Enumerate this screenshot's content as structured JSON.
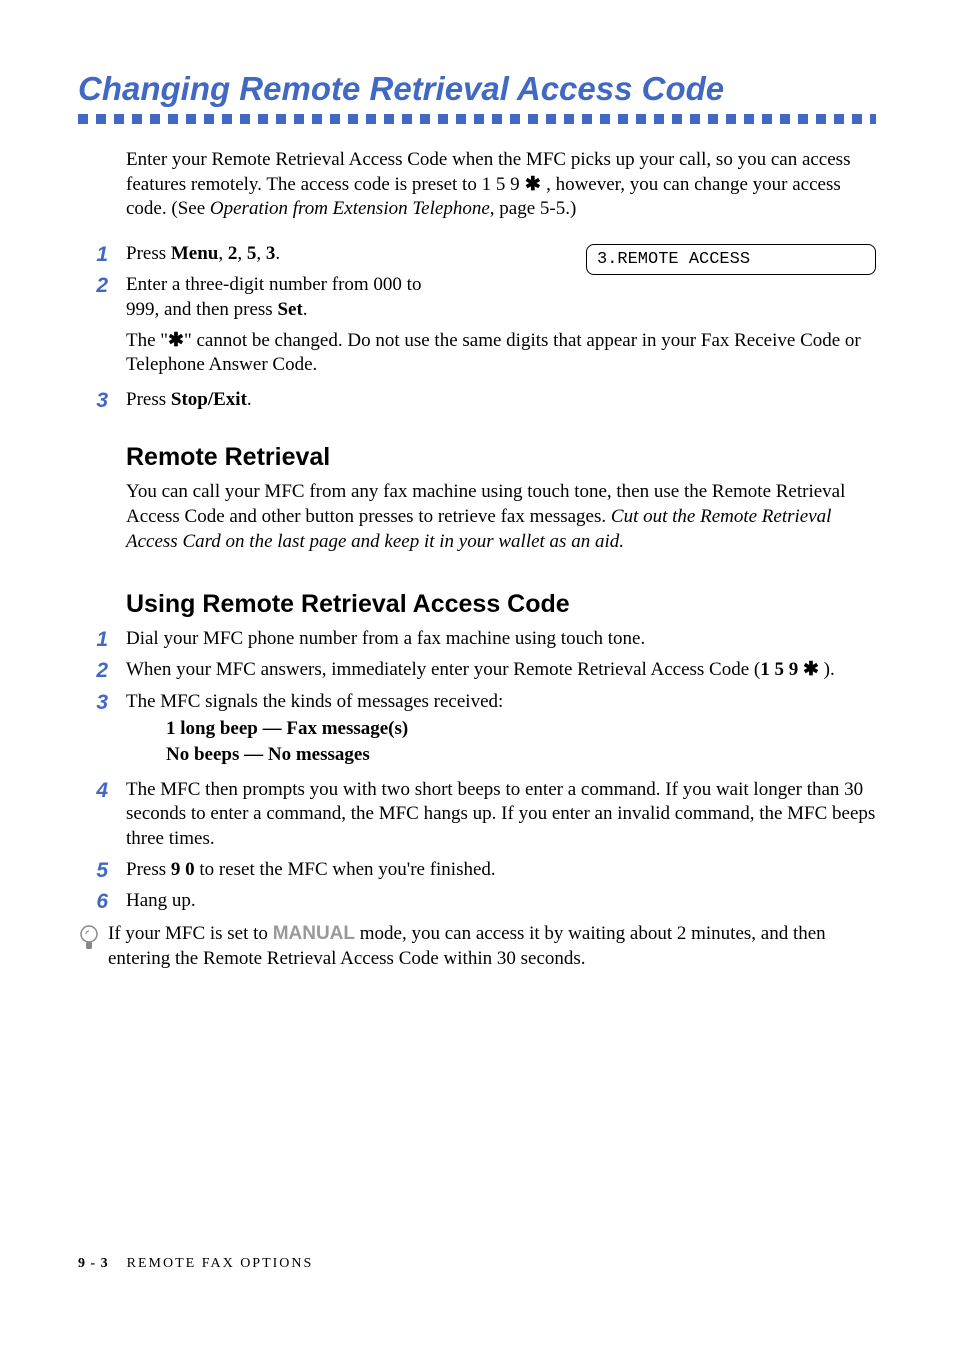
{
  "title": "Changing Remote Retrieval Access Code",
  "intro": {
    "pre": "Enter your Remote Retrieval Access Code when the MFC picks up your call, so you can access features remotely.  The access code is preset to 1 5 9",
    "star": " ✱ ",
    "mid": ", however, you can change your access code. (See ",
    "ital": "Operation from Extension Telephone",
    "post": ", page 5-5.)"
  },
  "lcd": "3.REMOTE ACCESS",
  "step1": {
    "n": "1",
    "pre": "Press ",
    "b1": "Menu",
    "s1": ", ",
    "b2": "2",
    "s2": ", ",
    "b3": "5",
    "s3": ", ",
    "b4": "3",
    "post": "."
  },
  "step2": {
    "n": "2",
    "line1_pre": "Enter a three-digit number from 000 to 999, and then press ",
    "line1_bold": "Set",
    "line1_post": ".",
    "line2_pre": "The \"",
    "line2_star": "✱",
    "line2_post": "\" cannot be changed. Do not use the same digits that appear in your Fax Receive Code or Telephone Answer Code."
  },
  "step3": {
    "n": "3",
    "pre": "Press ",
    "bold": "Stop/Exit",
    "post": "."
  },
  "h2a": "Remote Retrieval",
  "para_a": {
    "pre": "You can call your MFC from any fax machine using touch tone, then use the Remote Retrieval Access Code and other button presses to retrieve fax messages. ",
    "ital": "Cut out the Remote Retrieval Access Card on the last page and keep it in your wallet as an aid."
  },
  "h2b": "Using Remote Retrieval Access Code",
  "u1": {
    "n": "1",
    "t": "Dial your MFC phone number from a fax machine using touch tone."
  },
  "u2": {
    "n": "2",
    "pre": "When your MFC answers, immediately enter your Remote Retrieval Access Code (",
    "bold": "1 5 9 ",
    "star": "✱",
    "post": " )."
  },
  "u3": {
    "n": "3",
    "t": "The MFC signals the kinds of messages received:",
    "s1": "1 long beep — Fax message(s)",
    "s2": "No beeps — No messages"
  },
  "u4": {
    "n": "4",
    "t": "The MFC then prompts you with two short beeps to enter a command.  If you wait longer than 30 seconds to enter a command, the MFC hangs up.  If you enter an invalid command, the MFC beeps three times."
  },
  "u5": {
    "n": "5",
    "pre": "Press ",
    "bold": "9 0",
    "post": " to reset the MFC when you're finished."
  },
  "u6": {
    "n": "6",
    "t": "Hang up."
  },
  "tip": {
    "pre": "If your MFC is set to ",
    "manual": "MANUAL",
    "post": " mode, you can access it by waiting about 2 minutes, and then entering the Remote Retrieval Access Code within 30 seconds."
  },
  "footer": {
    "page": "9 - 3",
    "section": "REMOTE FAX OPTIONS"
  }
}
